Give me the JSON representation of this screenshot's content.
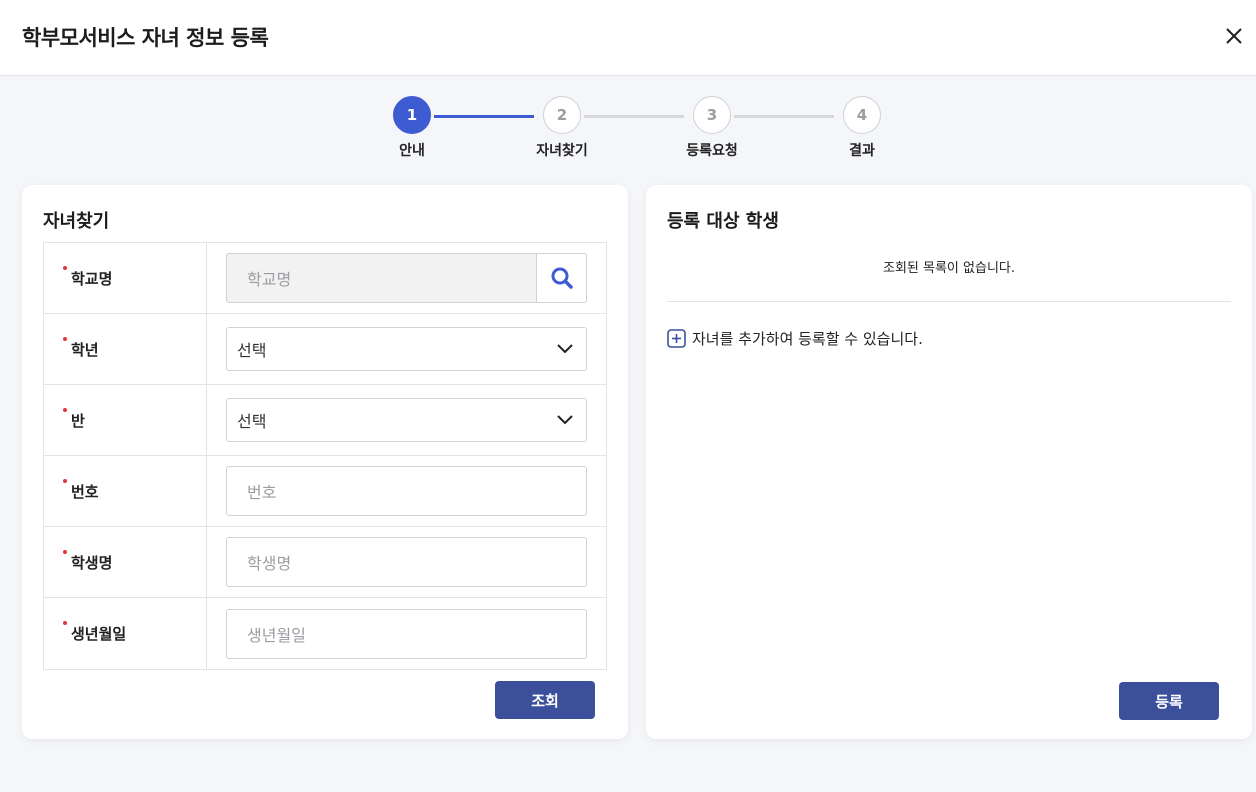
{
  "header": {
    "title": "학부모서비스 자녀 정보 등록"
  },
  "stepper": {
    "steps": [
      {
        "number": "1",
        "label": "안내"
      },
      {
        "number": "2",
        "label": "자녀찾기"
      },
      {
        "number": "3",
        "label": "등록요청"
      },
      {
        "number": "4",
        "label": "결과"
      }
    ],
    "active_step": 1,
    "accent_color": "#3e5cd1"
  },
  "search_panel": {
    "title": "자녀찾기",
    "fields": {
      "school": {
        "label": "학교명",
        "placeholder": "학교명"
      },
      "grade": {
        "label": "학년",
        "value": "선택"
      },
      "class": {
        "label": "반",
        "value": "선택"
      },
      "number": {
        "label": "번호",
        "placeholder": "번호"
      },
      "student_name": {
        "label": "학생명",
        "placeholder": "학생명"
      },
      "birthdate": {
        "label": "생년월일",
        "placeholder": "생년월일"
      }
    },
    "submit_label": "조회"
  },
  "target_panel": {
    "title": "등록 대상 학생",
    "empty_message": "조회된 목록이 없습니다.",
    "add_hint": "자녀를 추가하여 등록할 수 있습니다.",
    "register_label": "등록"
  },
  "colors": {
    "primary_button": "#3b4f9b",
    "required_dot": "#e0383a",
    "search_icon": "#3e5cd1"
  }
}
